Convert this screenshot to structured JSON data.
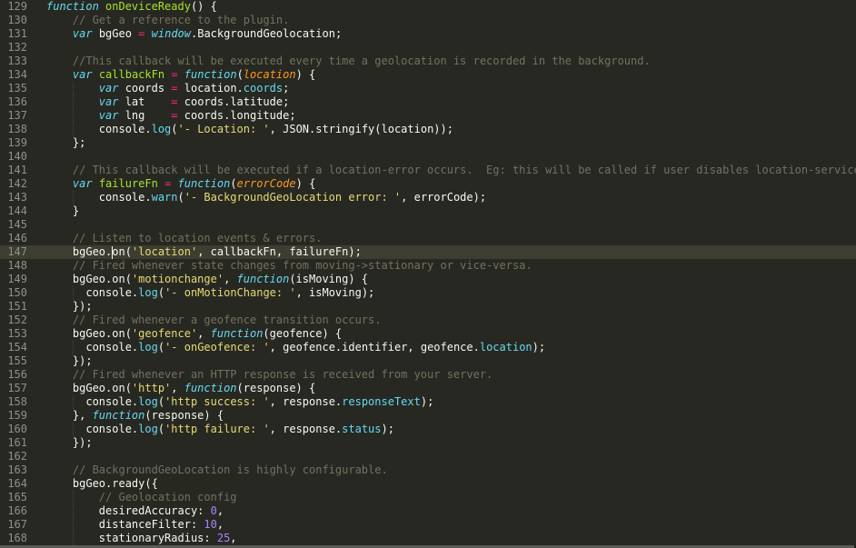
{
  "editor": {
    "theme_colors": {
      "background": "#272822",
      "foreground": "#f8f8f2",
      "comment": "#75715e",
      "storage": "#66d9ef",
      "function_name": "#a6e22e",
      "parameter": "#fd971f",
      "string": "#e6db74",
      "number": "#ae81ff",
      "operator": "#f92672",
      "line_number": "#8f908a",
      "active_line": "#3e3d32"
    },
    "active_line": 147,
    "cursor_line": 147,
    "lines": [
      {
        "n": "129",
        "tokens": [
          [
            "storage",
            "function"
          ],
          [
            "plain",
            " "
          ],
          [
            "fname",
            "onDeviceReady"
          ],
          [
            "plain",
            "() {"
          ]
        ]
      },
      {
        "n": "130",
        "tokens": [
          [
            "plain",
            "    "
          ],
          [
            "comment",
            "// Get a reference to the plugin."
          ]
        ]
      },
      {
        "n": "131",
        "tokens": [
          [
            "plain",
            "    "
          ],
          [
            "storage",
            "var"
          ],
          [
            "plain",
            " bgGeo "
          ],
          [
            "op",
            "="
          ],
          [
            "plain",
            " "
          ],
          [
            "storage",
            "window"
          ],
          [
            "plain",
            ".BackgroundGeolocation;"
          ]
        ]
      },
      {
        "n": "132",
        "tokens": [
          [
            "plain",
            ""
          ]
        ]
      },
      {
        "n": "133",
        "tokens": [
          [
            "plain",
            "    "
          ],
          [
            "comment",
            "//This callback will be executed every time a geolocation is recorded in the background."
          ]
        ]
      },
      {
        "n": "134",
        "tokens": [
          [
            "plain",
            "    "
          ],
          [
            "storage",
            "var"
          ],
          [
            "plain",
            " "
          ],
          [
            "fname",
            "callbackFn"
          ],
          [
            "plain",
            " "
          ],
          [
            "op",
            "="
          ],
          [
            "plain",
            " "
          ],
          [
            "storage",
            "function"
          ],
          [
            "plain",
            "("
          ],
          [
            "param",
            "location"
          ],
          [
            "plain",
            ") {"
          ]
        ]
      },
      {
        "n": "135",
        "tokens": [
          [
            "plain",
            "        "
          ],
          [
            "storage",
            "var"
          ],
          [
            "plain",
            " coords "
          ],
          [
            "op",
            "="
          ],
          [
            "plain",
            " location."
          ],
          [
            "support",
            "coords"
          ],
          [
            "plain",
            ";"
          ]
        ]
      },
      {
        "n": "136",
        "tokens": [
          [
            "plain",
            "        "
          ],
          [
            "storage",
            "var"
          ],
          [
            "plain",
            " lat    "
          ],
          [
            "op",
            "="
          ],
          [
            "plain",
            " coords.latitude;"
          ]
        ]
      },
      {
        "n": "137",
        "tokens": [
          [
            "plain",
            "        "
          ],
          [
            "storage",
            "var"
          ],
          [
            "plain",
            " lng    "
          ],
          [
            "op",
            "="
          ],
          [
            "plain",
            " coords.longitude;"
          ]
        ]
      },
      {
        "n": "138",
        "tokens": [
          [
            "plain",
            "        console."
          ],
          [
            "support",
            "log"
          ],
          [
            "plain",
            "("
          ],
          [
            "string",
            "'- Location: '"
          ],
          [
            "plain",
            ", JSON.stringify(location));"
          ]
        ]
      },
      {
        "n": "139",
        "tokens": [
          [
            "plain",
            "    };"
          ]
        ]
      },
      {
        "n": "140",
        "tokens": [
          [
            "plain",
            ""
          ]
        ]
      },
      {
        "n": "141",
        "tokens": [
          [
            "plain",
            "    "
          ],
          [
            "comment",
            "// This callback will be executed if a location-error occurs.  Eg: this will be called if user disables location-services."
          ]
        ]
      },
      {
        "n": "142",
        "tokens": [
          [
            "plain",
            "    "
          ],
          [
            "storage",
            "var"
          ],
          [
            "plain",
            " "
          ],
          [
            "fname",
            "failureFn"
          ],
          [
            "plain",
            " "
          ],
          [
            "op",
            "="
          ],
          [
            "plain",
            " "
          ],
          [
            "storage",
            "function"
          ],
          [
            "plain",
            "("
          ],
          [
            "param",
            "errorCode"
          ],
          [
            "plain",
            ") {"
          ]
        ]
      },
      {
        "n": "143",
        "tokens": [
          [
            "plain",
            "        console."
          ],
          [
            "support",
            "warn"
          ],
          [
            "plain",
            "("
          ],
          [
            "string",
            "'- BackgroundGeoLocation error: '"
          ],
          [
            "plain",
            ", errorCode);"
          ]
        ]
      },
      {
        "n": "144",
        "tokens": [
          [
            "plain",
            "    }"
          ]
        ]
      },
      {
        "n": "145",
        "tokens": [
          [
            "plain",
            ""
          ]
        ]
      },
      {
        "n": "146",
        "tokens": [
          [
            "plain",
            "    "
          ],
          [
            "comment",
            "// Listen to location events & errors."
          ]
        ]
      },
      {
        "n": "147",
        "tokens": [
          [
            "plain",
            "    bgGeo."
          ],
          [
            "cursor",
            ""
          ],
          [
            "plain",
            "on("
          ],
          [
            "string",
            "'location'"
          ],
          [
            "plain",
            ", callbackFn, failureFn);"
          ]
        ]
      },
      {
        "n": "148",
        "tokens": [
          [
            "plain",
            "    "
          ],
          [
            "comment",
            "// Fired whenever state changes from moving->stationary or vice-versa."
          ]
        ]
      },
      {
        "n": "149",
        "tokens": [
          [
            "plain",
            "    bgGeo.on("
          ],
          [
            "string",
            "'motionchange'"
          ],
          [
            "plain",
            ", "
          ],
          [
            "storage",
            "function"
          ],
          [
            "plain",
            "(isMoving) {"
          ]
        ]
      },
      {
        "n": "150",
        "tokens": [
          [
            "plain",
            "      console."
          ],
          [
            "support",
            "log"
          ],
          [
            "plain",
            "("
          ],
          [
            "string",
            "'- onMotionChange: '"
          ],
          [
            "plain",
            ", isMoving);"
          ]
        ]
      },
      {
        "n": "151",
        "tokens": [
          [
            "plain",
            "    });"
          ]
        ]
      },
      {
        "n": "152",
        "tokens": [
          [
            "plain",
            "    "
          ],
          [
            "comment",
            "// Fired whenever a geofence transition occurs."
          ]
        ]
      },
      {
        "n": "153",
        "tokens": [
          [
            "plain",
            "    bgGeo.on("
          ],
          [
            "string",
            "'geofence'"
          ],
          [
            "plain",
            ", "
          ],
          [
            "storage",
            "function"
          ],
          [
            "plain",
            "(geofence) {"
          ]
        ]
      },
      {
        "n": "154",
        "tokens": [
          [
            "plain",
            "      console."
          ],
          [
            "support",
            "log"
          ],
          [
            "plain",
            "("
          ],
          [
            "string",
            "'- onGeofence: '"
          ],
          [
            "plain",
            ", geofence.identifier, geofence."
          ],
          [
            "support",
            "location"
          ],
          [
            "plain",
            ");"
          ]
        ]
      },
      {
        "n": "155",
        "tokens": [
          [
            "plain",
            "    });"
          ]
        ]
      },
      {
        "n": "156",
        "tokens": [
          [
            "plain",
            "    "
          ],
          [
            "comment",
            "// Fired whenever an HTTP response is received from your server."
          ]
        ]
      },
      {
        "n": "157",
        "tokens": [
          [
            "plain",
            "    bgGeo.on("
          ],
          [
            "string",
            "'http'"
          ],
          [
            "plain",
            ", "
          ],
          [
            "storage",
            "function"
          ],
          [
            "plain",
            "(response) {"
          ]
        ]
      },
      {
        "n": "158",
        "tokens": [
          [
            "plain",
            "      console."
          ],
          [
            "support",
            "log"
          ],
          [
            "plain",
            "("
          ],
          [
            "string",
            "'http success: '"
          ],
          [
            "plain",
            ", response."
          ],
          [
            "support",
            "responseText"
          ],
          [
            "plain",
            ");"
          ]
        ]
      },
      {
        "n": "159",
        "tokens": [
          [
            "plain",
            "    }, "
          ],
          [
            "storage",
            "function"
          ],
          [
            "plain",
            "(response) {"
          ]
        ]
      },
      {
        "n": "160",
        "tokens": [
          [
            "plain",
            "      console."
          ],
          [
            "support",
            "log"
          ],
          [
            "plain",
            "("
          ],
          [
            "string",
            "'http failure: '"
          ],
          [
            "plain",
            ", response."
          ],
          [
            "support",
            "status"
          ],
          [
            "plain",
            ");"
          ]
        ]
      },
      {
        "n": "161",
        "tokens": [
          [
            "plain",
            "    });"
          ]
        ]
      },
      {
        "n": "162",
        "tokens": [
          [
            "plain",
            ""
          ]
        ]
      },
      {
        "n": "163",
        "tokens": [
          [
            "plain",
            "    "
          ],
          [
            "comment",
            "// BackgroundGeoLocation is highly configurable."
          ]
        ]
      },
      {
        "n": "164",
        "tokens": [
          [
            "plain",
            "    bgGeo.ready({"
          ]
        ]
      },
      {
        "n": "165",
        "tokens": [
          [
            "plain",
            "        "
          ],
          [
            "comment",
            "// Geolocation config"
          ]
        ]
      },
      {
        "n": "166",
        "tokens": [
          [
            "plain",
            "        desiredAccuracy: "
          ],
          [
            "number",
            "0"
          ],
          [
            "plain",
            ","
          ]
        ]
      },
      {
        "n": "167",
        "tokens": [
          [
            "plain",
            "        distanceFilter: "
          ],
          [
            "number",
            "10"
          ],
          [
            "plain",
            ","
          ]
        ]
      },
      {
        "n": "168",
        "tokens": [
          [
            "plain",
            "        stationaryRadius: "
          ],
          [
            "number",
            "25"
          ],
          [
            "plain",
            ","
          ]
        ]
      }
    ]
  }
}
